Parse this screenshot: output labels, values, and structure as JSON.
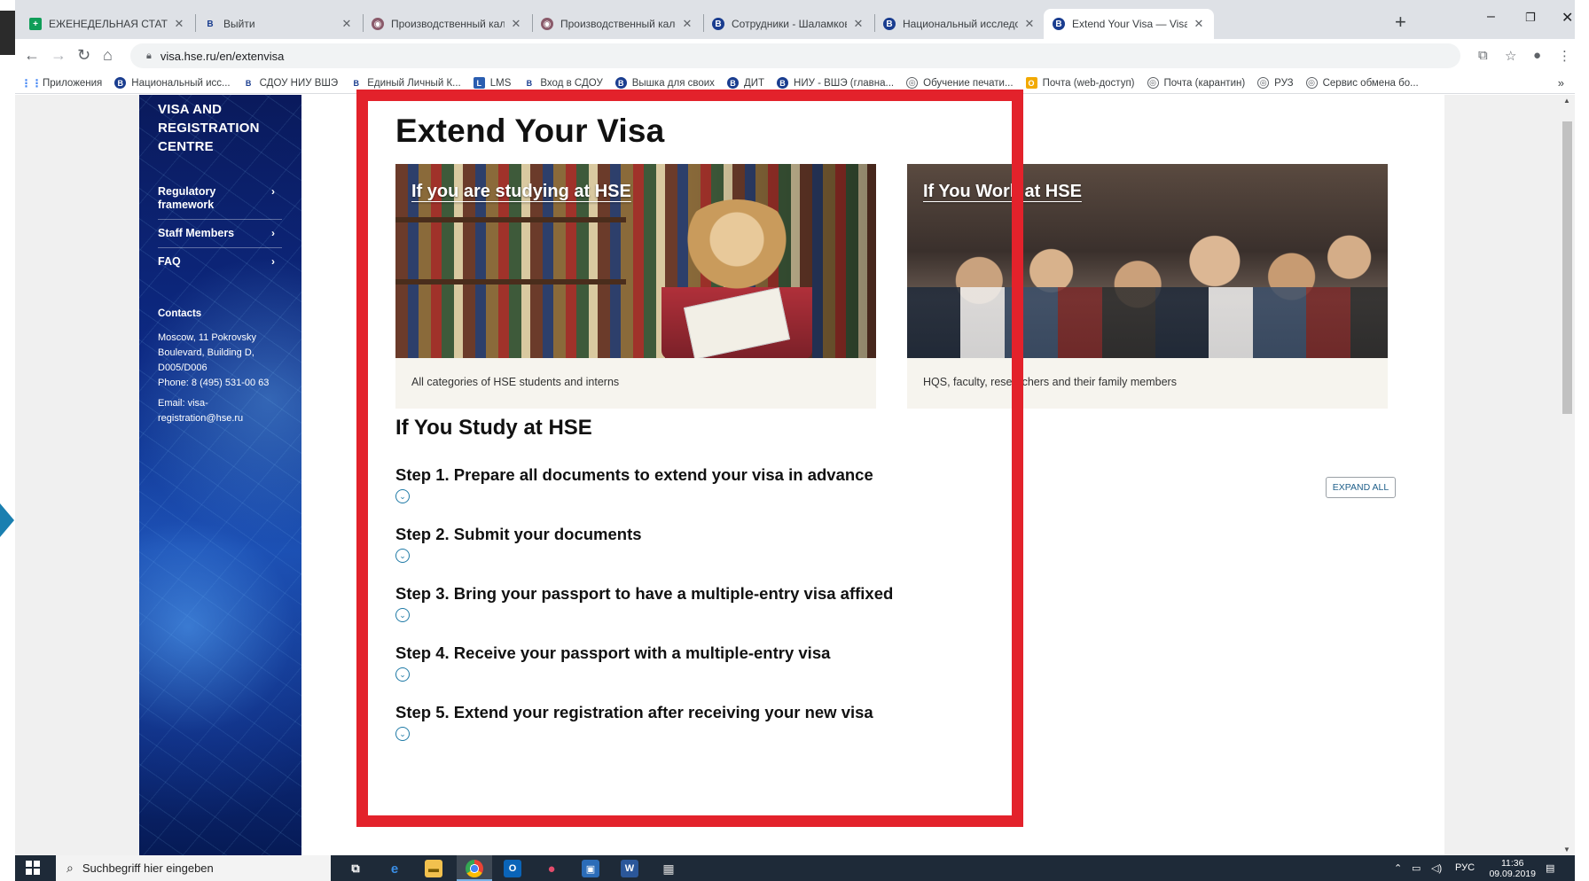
{
  "browser": {
    "tabs": [
      {
        "title": "ЕЖЕНЕДЕЛЬНАЯ СТАТИСТИКА",
        "icon": "sheets-icon",
        "active": false
      },
      {
        "title": "Выйти",
        "icon": "hse-icon",
        "active": false
      },
      {
        "title": "Производственный календарь",
        "icon": "calendar-site-icon",
        "active": false
      },
      {
        "title": "Производственный календарь",
        "icon": "calendar-site-icon",
        "active": false
      },
      {
        "title": "Сотрудники - Шаламков Сергей",
        "icon": "hse-icon",
        "active": false
      },
      {
        "title": "Национальный исследовательский",
        "icon": "hse-icon",
        "active": false
      },
      {
        "title": "Extend Your Visa — Visa and Reg",
        "icon": "hse-icon",
        "active": true
      }
    ],
    "url": "visa.hse.ru/en/extenvisa",
    "bookmarks": [
      {
        "label": "Приложения",
        "icon": "apps-grid-icon"
      },
      {
        "label": "Национальный исс...",
        "icon": "hse-icon"
      },
      {
        "label": "СДОУ НИУ ВШЭ",
        "icon": "hse-b-icon"
      },
      {
        "label": "Единый Личный К...",
        "icon": "hse-b-icon"
      },
      {
        "label": "LMS",
        "icon": "lms-icon"
      },
      {
        "label": "Вход в СДОУ",
        "icon": "hse-b-icon"
      },
      {
        "label": "Вышка для своих",
        "icon": "hse-icon"
      },
      {
        "label": "ДИТ",
        "icon": "hse-icon"
      },
      {
        "label": "НИУ - ВШЭ (главна...",
        "icon": "hse-icon"
      },
      {
        "label": "Обучение печати...",
        "icon": "globe-icon"
      },
      {
        "label": "Почта (web-доступ)",
        "icon": "mail-icon"
      },
      {
        "label": "Почта (карантин)",
        "icon": "globe-icon"
      },
      {
        "label": "РУЗ",
        "icon": "globe-icon"
      },
      {
        "label": "Сервис обмена бо...",
        "icon": "globe-icon"
      }
    ],
    "bookmarks_more": "»"
  },
  "sidebar": {
    "title": "VISA AND REGISTRATION CENTRE",
    "menu": [
      {
        "label": "Regulatory framework"
      },
      {
        "label": "Staff Members"
      },
      {
        "label": "FAQ"
      }
    ],
    "contacts": {
      "heading": "Contacts",
      "address": "Moscow, 11 Pokrovsky Boulevard, Building D, D005/D006",
      "phone": "Phone: 8 (495) 531-00 63",
      "email": "Email: visa-registration@hse.ru"
    }
  },
  "main": {
    "title": "Extend Your Visa",
    "cards": [
      {
        "title": "If you are studying at HSE",
        "description": "All categories of HSE students and interns"
      },
      {
        "title": "If You Work at HSE",
        "description": "HQS, faculty, researchers and their family members"
      }
    ],
    "section_title": "If You Study at HSE",
    "steps": [
      {
        "title": "Step 1. Prepare all documents to extend your visa in advance"
      },
      {
        "title": "Step 2. Submit your documents"
      },
      {
        "title": "Step 3. Bring your passport to have a multiple-entry visa affixed"
      },
      {
        "title": "Step 4. Receive your passport with a multiple-entry visa"
      },
      {
        "title": "Step 5. Extend your registration after receiving your new visa"
      }
    ],
    "expand_all": "EXPAND ALL"
  },
  "taskbar": {
    "search_placeholder": "Suchbegriff hier eingeben",
    "language": "РУС",
    "time": "11:36",
    "date": "09.09.2019"
  },
  "colors": {
    "highlight": "#e3222b",
    "sidebar": "#0d2a85",
    "accent": "#1f7aa6"
  }
}
